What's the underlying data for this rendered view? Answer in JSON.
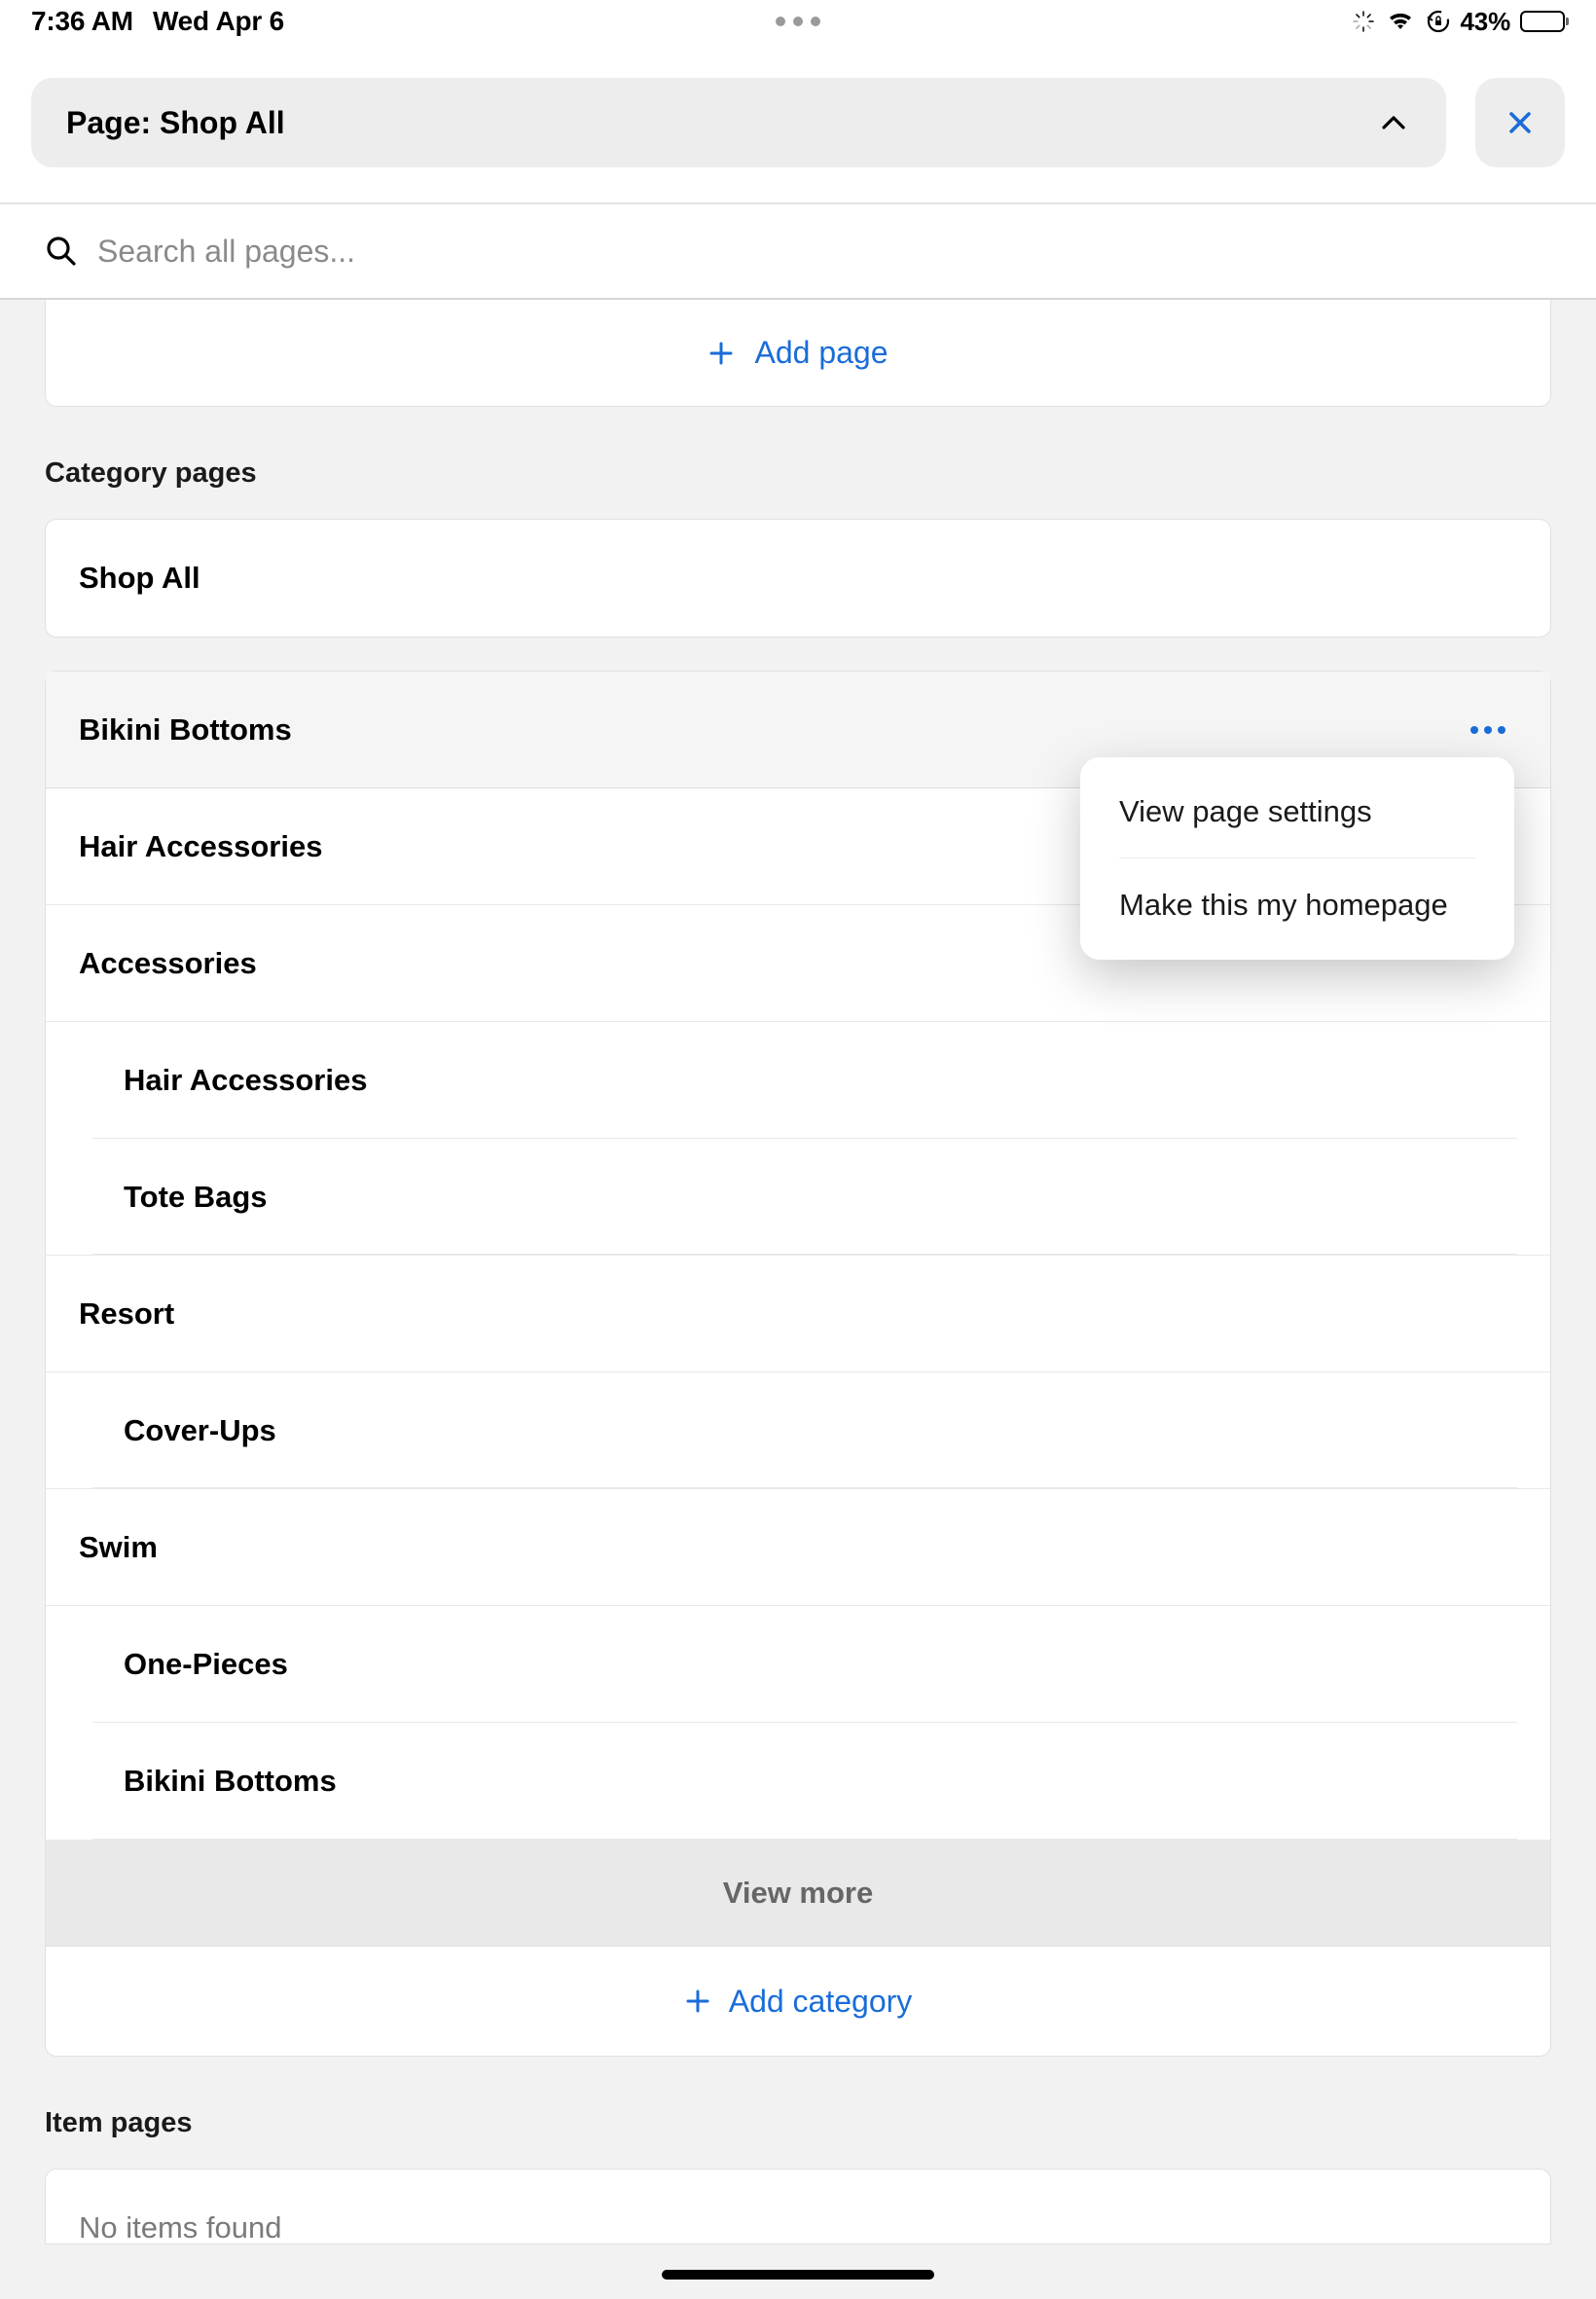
{
  "status": {
    "time": "7:36 AM",
    "date": "Wed Apr 6",
    "battery_pct": "43%"
  },
  "header": {
    "title": "Page: Shop All"
  },
  "search": {
    "placeholder": "Search all pages..."
  },
  "add_page_label": "Add page",
  "sections": {
    "category_heading": "Category pages",
    "item_heading": "Item pages"
  },
  "categories": {
    "shop_all": "Shop All",
    "bikini_bottoms": "Bikini Bottoms",
    "hair_accessories": "Hair Accessories",
    "accessories": "Accessories",
    "accessories_sub1": "Hair Accessories",
    "accessories_sub2": "Tote Bags",
    "resort": "Resort",
    "resort_sub1": "Cover-Ups",
    "swim": "Swim",
    "swim_sub1": "One-Pieces",
    "swim_sub2": "Bikini Bottoms",
    "view_more": "View more",
    "add_category": "Add category"
  },
  "items": {
    "empty": "No items found"
  },
  "context_menu": {
    "view_settings": "View page settings",
    "make_homepage": "Make this my homepage"
  }
}
